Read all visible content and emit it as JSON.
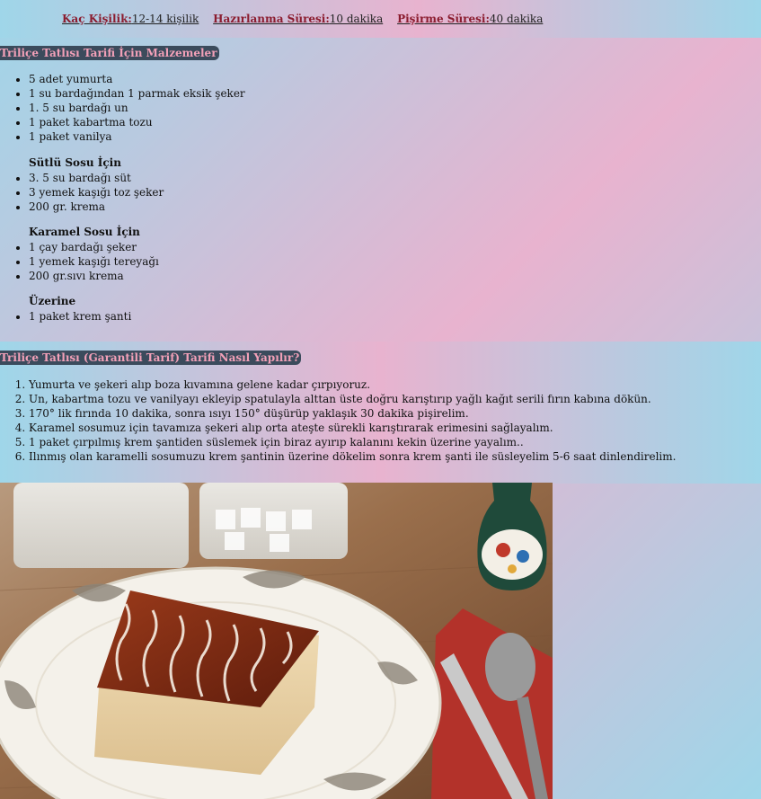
{
  "info": {
    "servings_label": "Kaç Kişilik:",
    "servings_value": "12-14 kişilik",
    "prep_label": "Hazırlanma Süresi:",
    "prep_value": "10 dakika",
    "cook_label": "Pişirme Süresi:",
    "cook_value": "40 dakika"
  },
  "ingredients": {
    "title": "Triliçe Tatlısı Tarifi İçin Malzemeler",
    "main": [
      "5 adet yumurta",
      "1 su bardağından 1 parmak eksik şeker",
      "1. 5 su bardağı un",
      "1 paket kabartma tozu",
      "1 paket vanilya"
    ],
    "milk_title": "Sütlü Sosu İçin",
    "milk": [
      "3. 5 su bardağı süt",
      "3 yemek kaşığı toz şeker",
      "200 gr. krema"
    ],
    "caramel_title": "Karamel Sosu İçin",
    "caramel": [
      "1 çay bardağı şeker",
      "1 yemek kaşığı tereyağı",
      "200 gr.sıvı krema"
    ],
    "topping_title": "Üzerine",
    "topping": [
      "1 paket krem şanti"
    ]
  },
  "steps": {
    "title": "Triliçe Tatlısı (Garantili Tarif) Tarifi Nasıl Yapılır?",
    "items": [
      "Yumurta ve şekeri alıp boza kıvamına gelene kadar çırpıyoruz.",
      "Un, kabartma tozu ve vanilyayı ekleyip spatulayla alttan üste doğru karıştırıp yağlı kağıt serili fırın kabına dökün.",
      "170° lik fırında 10 dakika, sonra ısıyı 150° düşürüp yaklaşık 30 dakika pişirelim.",
      "Karamel sosumuz için tavamıza şekeri alıp orta ateşte sürekli karıştırarak erimesini sağlayalım.",
      "1 paket çırpılmış krem şantiden süslemek için biraz ayırıp kalanını kekin üzerine yayalım..",
      "Ilınmış olan karamelli sosumuzu krem şantinin üzerine dökelim sonra krem şanti ile süsleyelim 5-6 saat dinlendirelim."
    ]
  },
  "photo": {
    "palette": {
      "wood": "#8a603f",
      "plate": "#f4f1ea",
      "cake": "#e8d4a8",
      "caramel": "#7a2a14"
    }
  }
}
